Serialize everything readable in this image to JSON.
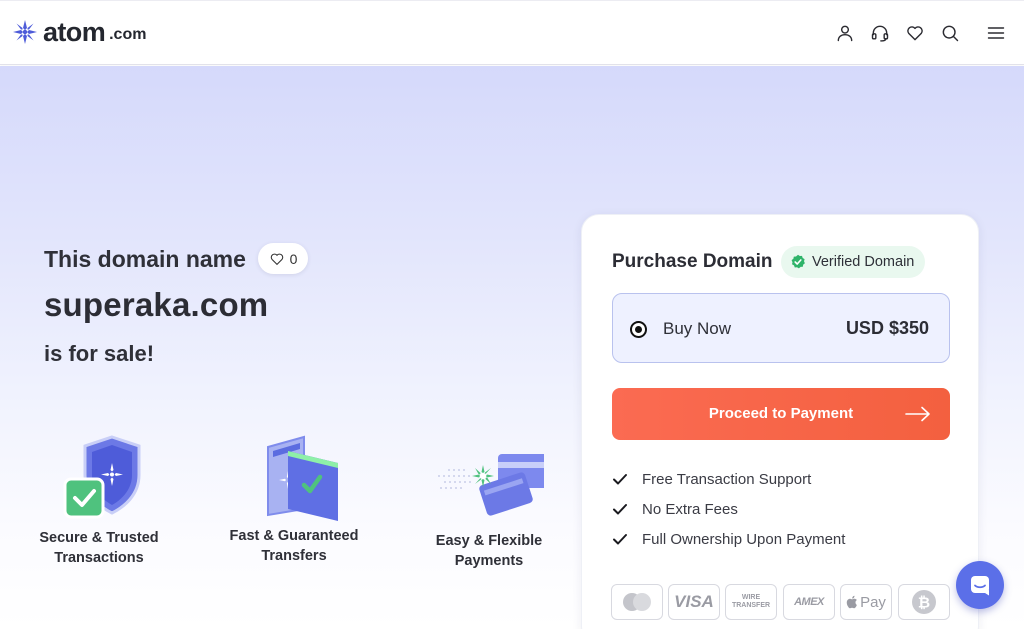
{
  "header": {
    "logo_word": "atom",
    "logo_suffix": ".com",
    "icons": [
      "user-icon",
      "headset-icon",
      "heart-icon",
      "search-icon",
      "menu-icon"
    ]
  },
  "hero": {
    "intro": "This domain name",
    "favorite_count": "0",
    "domain": "superaka.com",
    "for_sale": "is for sale!"
  },
  "features": [
    {
      "label": "Secure & Trusted Transactions",
      "icon": "shield-check-icon"
    },
    {
      "label": "Fast & Guaranteed Transfers",
      "icon": "transfer-folders-icon"
    },
    {
      "label": "Easy & Flexible Payments",
      "icon": "payment-cards-icon"
    }
  ],
  "purchase": {
    "title": "Purchase Domain",
    "verified_badge": "Verified Domain",
    "option_label": "Buy Now",
    "option_price": "USD $350",
    "button_label": "Proceed to Payment",
    "perks": [
      "Free Transaction Support",
      "No Extra Fees",
      "Full Ownership Upon Payment"
    ],
    "payment_methods": [
      "mastercard-icon",
      "VISA",
      "WIRE TRANSFER",
      "AMEX",
      "Pay",
      "bitcoin-icon"
    ]
  },
  "colors": {
    "accent": "#fb6b52",
    "brand": "#5b6fe8",
    "verified": "#2fb46a",
    "option_bg": "#eef1ff"
  }
}
